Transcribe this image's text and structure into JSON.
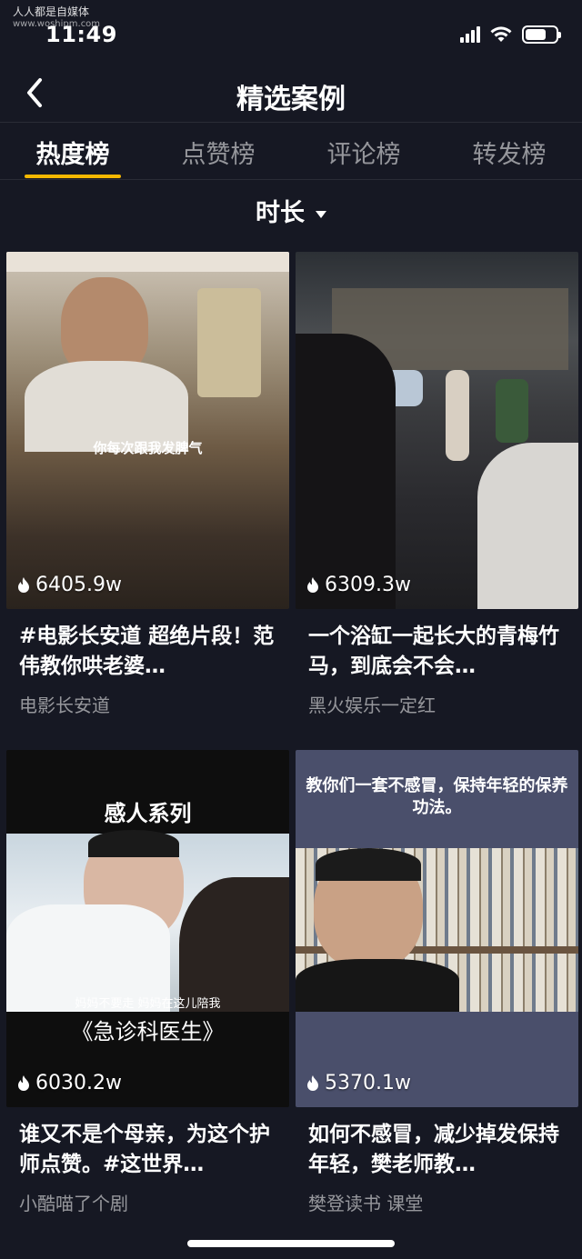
{
  "watermark": {
    "text": "人人都是自媒体",
    "url": "www.woshipm.com"
  },
  "status": {
    "time": "11:49"
  },
  "nav": {
    "title": "精选案例"
  },
  "tabs": [
    "热度榜",
    "点赞榜",
    "评论榜",
    "转发榜"
  ],
  "sort": {
    "label": "时长"
  },
  "cards": [
    {
      "count": "6405.9w",
      "title": "#电影长安道 超绝片段！范伟教你哄老婆…",
      "author": "电影长安道",
      "caption": "你每次跟我发脾气"
    },
    {
      "count": "6309.3w",
      "title": "一个浴缸一起长大的青梅竹马，到底会不会…",
      "author": "黑火娱乐一定红"
    },
    {
      "count": "6030.2w",
      "title": "谁又不是个母亲，为这个护师点赞。#这世界…",
      "author": "小酷喵了个剧",
      "caption_top": "感人系列",
      "caption_sub": "妈妈不要走 妈妈在这儿陪我",
      "caption_bottom": "《急诊科医生》"
    },
    {
      "count": "5370.1w",
      "title": "如何不感冒，减少掉发保持年轻，樊老师教…",
      "author": "樊登读书 课堂",
      "caption_top": "教你们一套不感冒，保持年轻的保养功法。"
    }
  ]
}
